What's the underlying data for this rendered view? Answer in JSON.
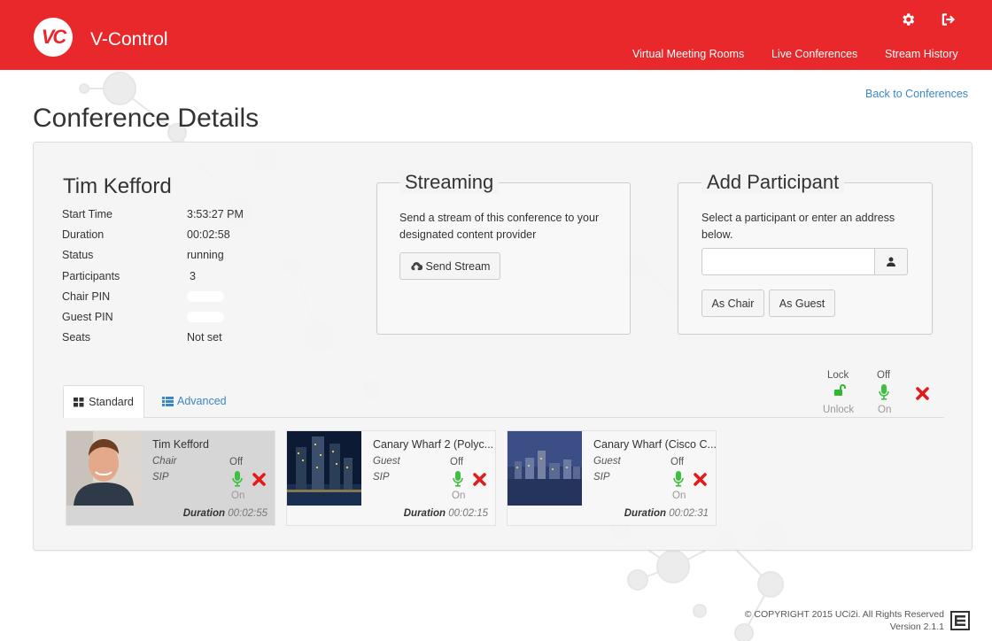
{
  "app": {
    "title": "V-Control",
    "logo_text": "VC"
  },
  "nav": {
    "items": [
      "Virtual Meeting Rooms",
      "Live Conferences",
      "Stream History"
    ]
  },
  "back_link": "Back to Conferences",
  "page_title": "Conference Details",
  "conference": {
    "name": "Tim Kefford",
    "fields": [
      {
        "label": "Start Time",
        "value": "3:53:27 PM"
      },
      {
        "label": "Duration",
        "value": "00:02:58"
      },
      {
        "label": "Status",
        "value": "running"
      },
      {
        "label": "Participants",
        "value": "3"
      },
      {
        "label": "Chair PIN",
        "value": ""
      },
      {
        "label": "Guest PIN",
        "value": ""
      },
      {
        "label": "Seats",
        "value": "Not set"
      }
    ]
  },
  "streaming": {
    "title": "Streaming",
    "description": "Send a stream of this conference to your designated content provider",
    "button": "Send Stream"
  },
  "add_participant": {
    "title": "Add Participant",
    "description": "Select a participant or enter an address below.",
    "input_value": "",
    "as_chair": "As Chair",
    "as_guest": "As Guest"
  },
  "tabs": {
    "standard": "Standard",
    "advanced": "Advanced"
  },
  "global_controls": {
    "lock": "Lock",
    "unlock": "Unlock",
    "off": "Off",
    "on": "On"
  },
  "participants": [
    {
      "name": "Tim Kefford",
      "role": "Chair",
      "protocol": "SIP",
      "off": "Off",
      "on": "On",
      "duration_label": "Duration",
      "duration": "00:02:55"
    },
    {
      "name": "Canary Wharf 2 (Polyc...",
      "role": "Guest",
      "protocol": "SIP",
      "off": "Off",
      "on": "On",
      "duration_label": "Duration",
      "duration": "00:02:15"
    },
    {
      "name": "Canary Wharf (Cisco C...",
      "role": "Guest",
      "protocol": "SIP",
      "off": "Off",
      "on": "On",
      "duration_label": "Duration",
      "duration": "00:02:31"
    }
  ],
  "footer": {
    "copyright": "© COPYRIGHT 2015 UCi2i. All Rights Reserved",
    "version": "Version 2.1.1"
  },
  "colors": {
    "brand": "#e8282b",
    "link": "#3a87c8",
    "mic_green": "#3fbf3f",
    "remove_red": "#e41b1b"
  }
}
